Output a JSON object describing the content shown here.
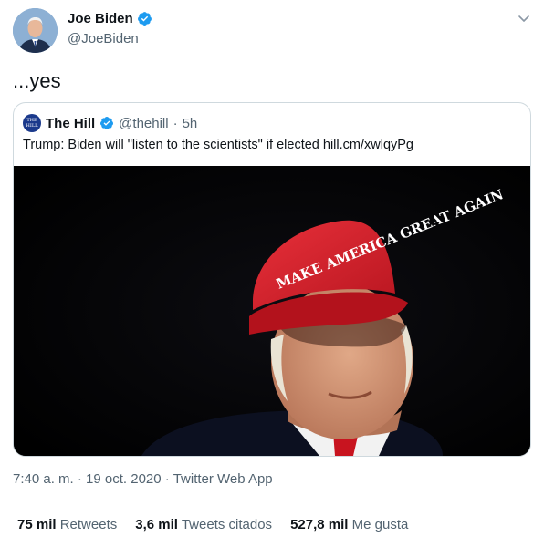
{
  "author": {
    "name": "Joe Biden",
    "handle": "@JoeBiden",
    "verified": true
  },
  "tweet": {
    "text": "...yes"
  },
  "quoted": {
    "logo_text": "THE HILL",
    "name": "The Hill",
    "handle": "@thehill",
    "sep": "·",
    "time": "5h",
    "text": "Trump: Biden will \"listen to the scientists\" if elected hill.cm/xwlqyPg",
    "image_cap_text": "MAKE AMERICA GREAT AGAIN"
  },
  "meta": {
    "time": "7:40 a. m.",
    "sep1": " · ",
    "date": "19 oct. 2020",
    "sep2": " · ",
    "source": "Twitter Web App"
  },
  "stats": {
    "retweets_count": "75 mil",
    "retweets_label": "Retweets",
    "quotes_count": "3,6 mil",
    "quotes_label": "Tweets citados",
    "likes_count": "527,8 mil",
    "likes_label": "Me gusta"
  },
  "colors": {
    "verified": "#1d9bf0",
    "muted": "#536471",
    "hill_blue": "#1b3a8c",
    "cap_red": "#d8212c"
  },
  "icons": {
    "verified": "verified-badge-icon",
    "more": "chevron-down-icon"
  }
}
